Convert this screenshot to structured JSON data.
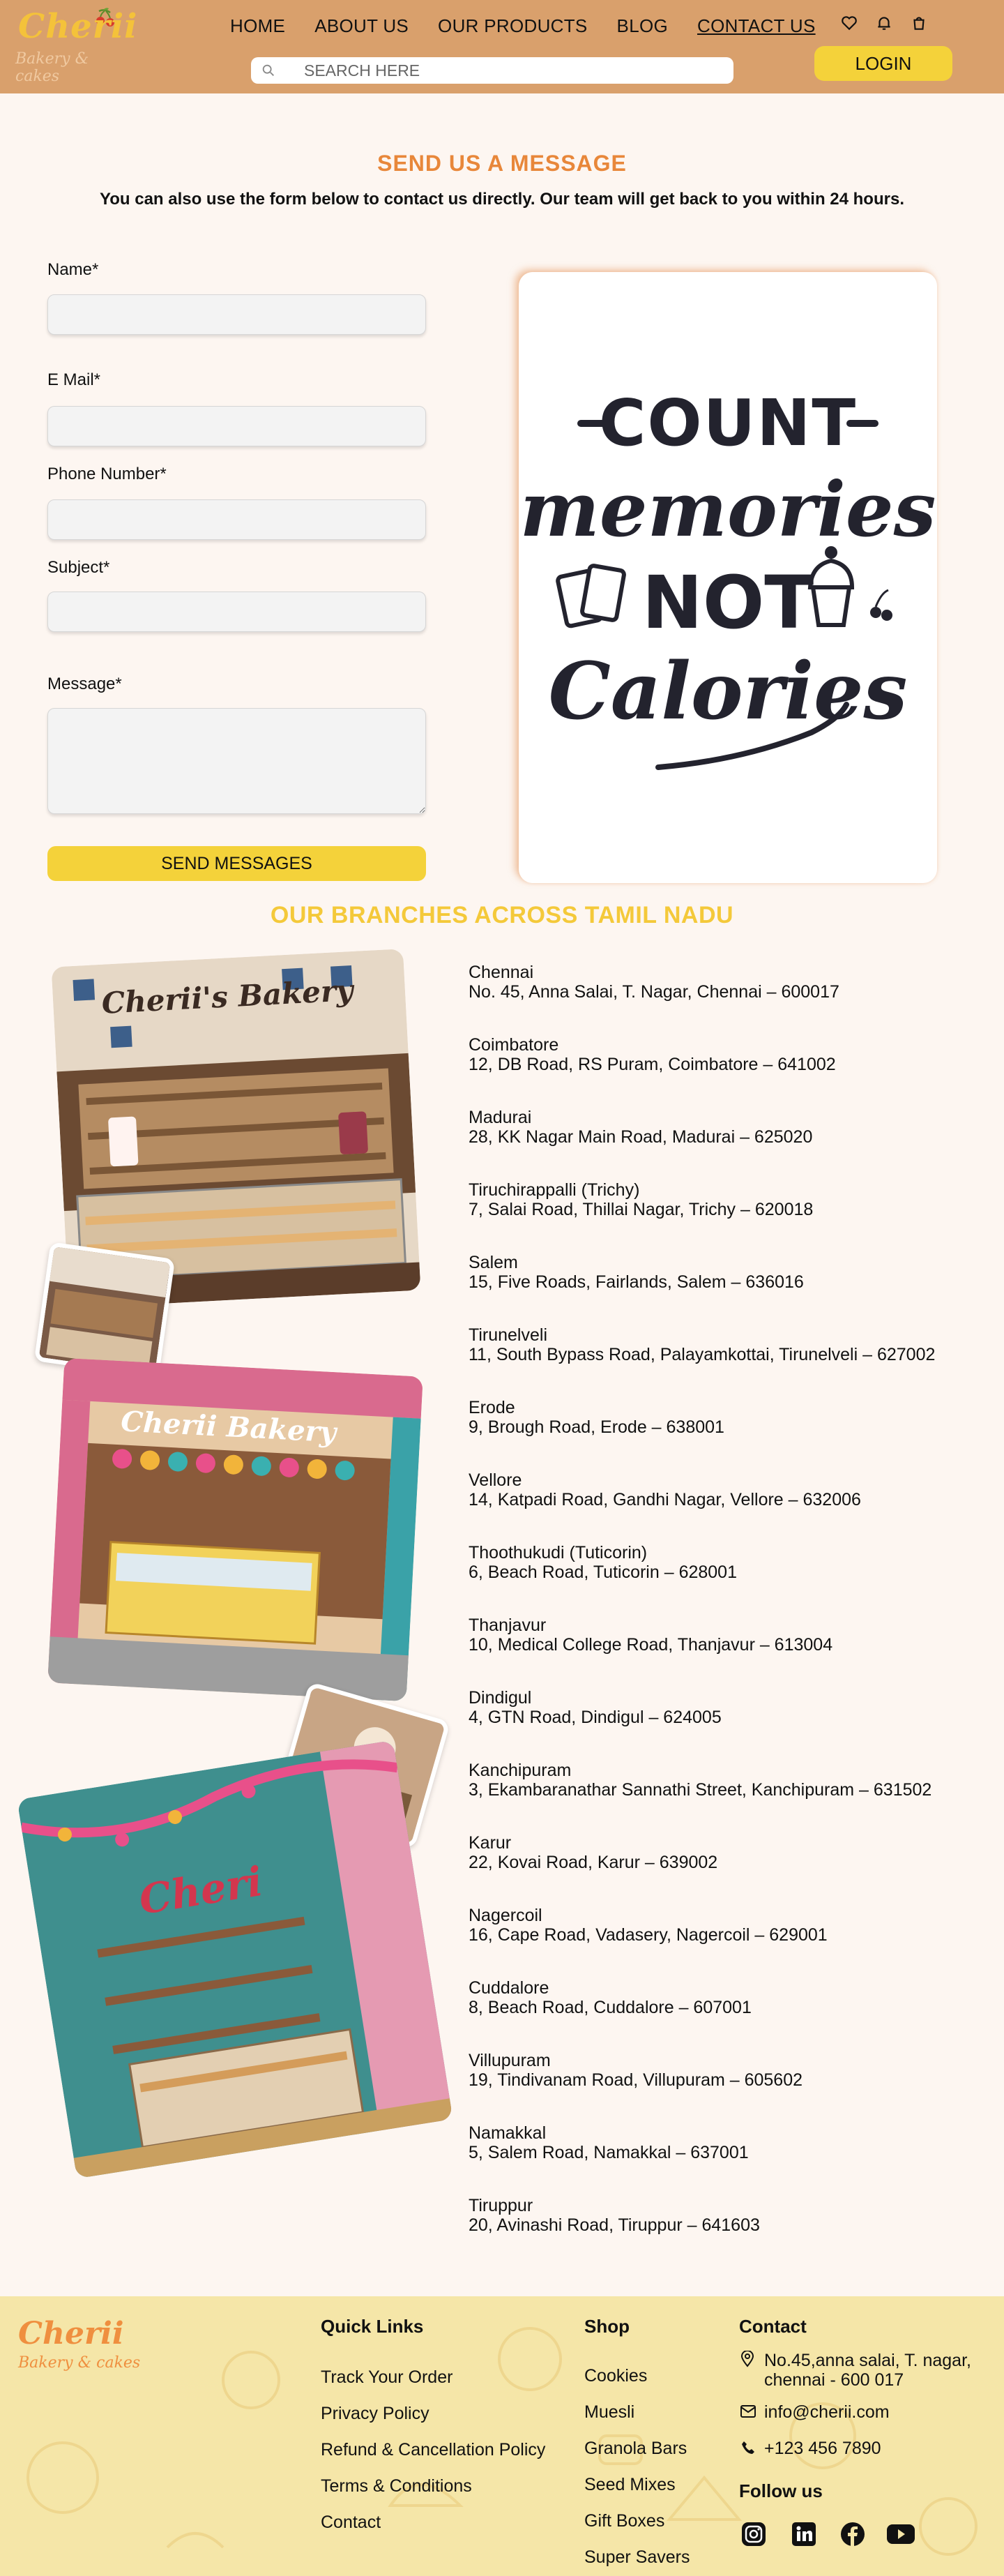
{
  "header": {
    "brand": "Cherii",
    "tagline": "Bakery & cakes",
    "nav": [
      "HOME",
      "ABOUT US",
      "OUR PRODUCTS",
      "BLOG",
      "CONTACT US"
    ],
    "active_nav": "CONTACT US",
    "icons": [
      "heart-icon",
      "bell-icon",
      "cart-icon"
    ],
    "search_placeholder": "SEARCH HERE",
    "login_label": "LOGIN"
  },
  "contact": {
    "title": "SEND US A MESSAGE",
    "subtitle": "You can also use the form below to contact us directly. Our team will get back to you within 24 hours.",
    "fields": {
      "name": "Name*",
      "email": "E Mail*",
      "phone": "Phone Number*",
      "subject": "Subject*",
      "message": "Message*"
    },
    "send_label": "SEND MESSAGES",
    "quote": {
      "line1": "COUNT",
      "line2": "memories",
      "line3": "NOT",
      "line4": "Calories"
    }
  },
  "branches": {
    "title": "OUR BRANCHES ACROSS TAMIL NADU",
    "photo_signs": [
      "Cherii's Bakery",
      "Cherii Bakery",
      "Cheri"
    ],
    "items": [
      {
        "city": "Chennai",
        "address": "No. 45, Anna Salai, T. Nagar, Chennai – 600017"
      },
      {
        "city": "Coimbatore",
        "address": "12, DB Road, RS Puram, Coimbatore – 641002"
      },
      {
        "city": "Madurai",
        "address": "28, KK Nagar Main Road, Madurai – 625020"
      },
      {
        "city": "Tiruchirappalli (Trichy)",
        "address": "7, Salai Road, Thillai Nagar, Trichy – 620018"
      },
      {
        "city": "Salem",
        "address": "15, Five Roads, Fairlands, Salem – 636016"
      },
      {
        "city": "Tirunelveli",
        "address": "11, South Bypass Road, Palayamkottai, Tirunelveli – 627002"
      },
      {
        "city": "Erode",
        "address": "9, Brough Road, Erode – 638001"
      },
      {
        "city": "Vellore",
        "address": "14, Katpadi Road, Gandhi Nagar, Vellore – 632006"
      },
      {
        "city": "Thoothukudi (Tuticorin)",
        "address": "6, Beach Road, Tuticorin – 628001"
      },
      {
        "city": "Thanjavur",
        "address": "10, Medical College Road, Thanjavur – 613004"
      },
      {
        "city": "Dindigul",
        "address": "4, GTN Road, Dindigul – 624005"
      },
      {
        "city": "Kanchipuram",
        "address": "3, Ekambaranathar Sannathi Street, Kanchipuram – 631502"
      },
      {
        "city": "Karur",
        "address": "22, Kovai Road, Karur – 639002"
      },
      {
        "city": "Nagercoil",
        "address": "16, Cape Road, Vadasery, Nagercoil – 629001"
      },
      {
        "city": "Cuddalore",
        "address": "8, Beach Road, Cuddalore – 607001"
      },
      {
        "city": "Villupuram",
        "address": "19, Tindivanam Road, Villupuram – 605602"
      },
      {
        "city": "Namakkal",
        "address": "5, Salem Road, Namakkal – 637001"
      },
      {
        "city": "Tiruppur",
        "address": "20, Avinashi Road, Tiruppur – 641603"
      }
    ]
  },
  "footer": {
    "brand": "Cherii",
    "tagline": "Bakery & cakes",
    "quick_links_title": "Quick Links",
    "quick_links": [
      "Track Your Order",
      "Privacy Policy",
      "Refund & Cancellation Policy",
      "Terms & Conditions",
      "Contact"
    ],
    "shop_title": "Shop",
    "shop_links": [
      "Cookies",
      "Muesli",
      "Granola Bars",
      "Seed Mixes",
      "Gift Boxes",
      "Super Savers"
    ],
    "contact_title": "Contact",
    "address_line1": "No.45,anna salai, T. nagar,",
    "address_line2": "chennai - 600 017",
    "email": "info@cherii.com",
    "phone": "+123 456 7890",
    "follow_title": "Follow us",
    "social_icons": [
      "instagram-icon",
      "linkedin-icon",
      "facebook-icon",
      "youtube-icon"
    ]
  },
  "colors": {
    "header_bg": "#d9a06c",
    "accent_orange": "#e8873a",
    "accent_yellow": "#f4d23a",
    "page_bg": "#fdf6f1",
    "footer_bg": "#f5e6a8"
  }
}
